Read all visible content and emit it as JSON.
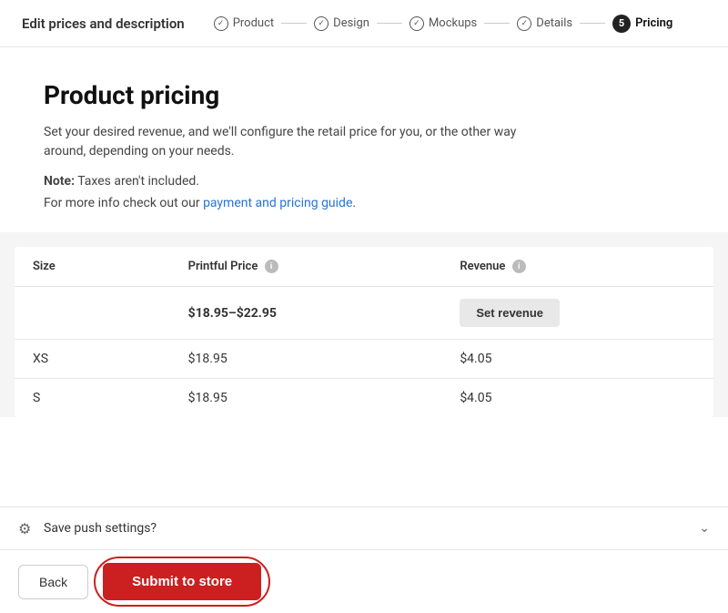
{
  "header": {
    "title": "Edit prices and description",
    "steps": [
      {
        "id": "product",
        "label": "Product",
        "done": true,
        "number": null
      },
      {
        "id": "design",
        "label": "Design",
        "done": true,
        "number": null
      },
      {
        "id": "mockups",
        "label": "Mockups",
        "done": true,
        "number": null
      },
      {
        "id": "details",
        "label": "Details",
        "done": true,
        "number": null
      },
      {
        "id": "pricing",
        "label": "Pricing",
        "done": false,
        "number": "5",
        "active": true
      }
    ],
    "checkmark": "✓"
  },
  "main": {
    "page_title": "Product pricing",
    "description": "Set your desired revenue, and we'll configure the retail price for you, or the other way around, depending on your needs.",
    "note_bold": "Note:",
    "note_text": " Taxes aren't included.",
    "guide_prefix": "For more info check out our ",
    "guide_link_text": "payment and pricing guide",
    "guide_suffix": "."
  },
  "table": {
    "col_size": "Size",
    "col_price": "Printful Price",
    "col_revenue": "Revenue",
    "rows": [
      {
        "size": "",
        "price": "$18.95–$22.95",
        "revenue": "",
        "is_range": true
      },
      {
        "size": "XS",
        "price": "$18.95",
        "revenue": "$4.05",
        "is_range": false
      },
      {
        "size": "S",
        "price": "$18.95",
        "revenue": "$4.05",
        "is_range": false
      }
    ],
    "set_revenue_label": "Set revenue"
  },
  "save_settings": {
    "label": "Save push settings?"
  },
  "actions": {
    "back_label": "Back",
    "submit_label": "Submit to store"
  },
  "icons": {
    "info": "i",
    "gear": "⚙",
    "chevron_down": "˅",
    "checkmark": "✓"
  }
}
